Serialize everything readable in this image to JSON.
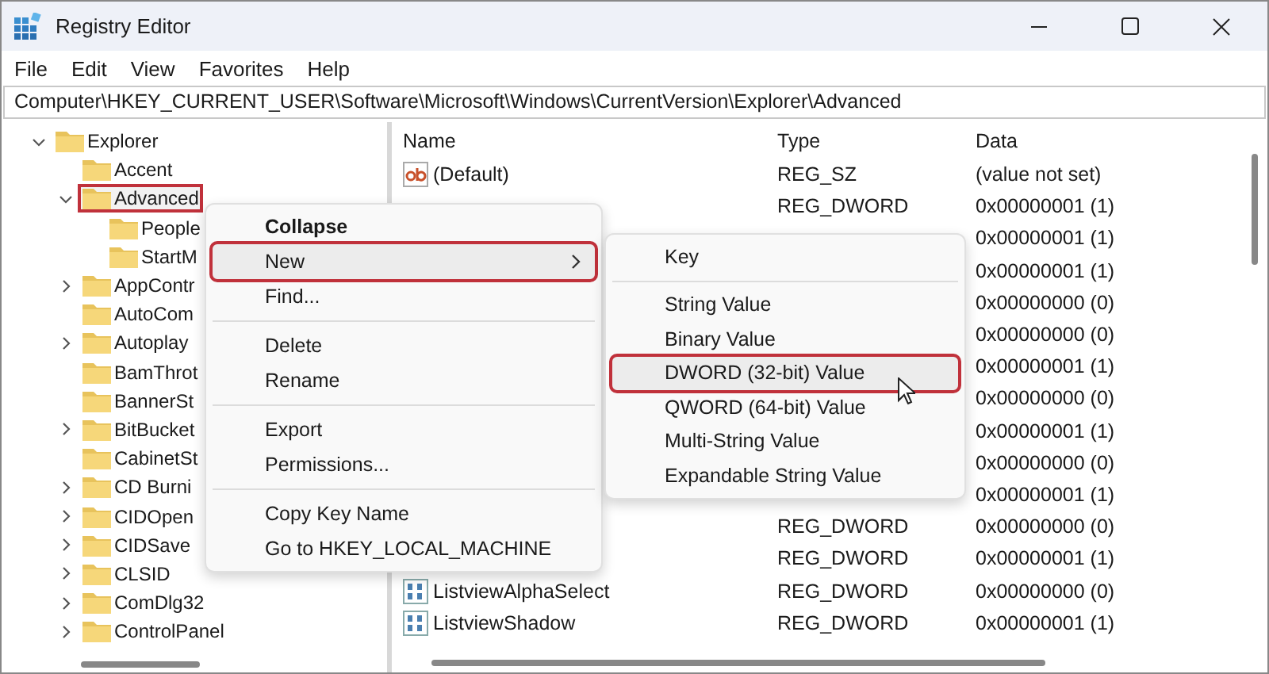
{
  "window": {
    "title": "Registry Editor"
  },
  "menu_bar": [
    "File",
    "Edit",
    "View",
    "Favorites",
    "Help"
  ],
  "address": "Computer\\HKEY_CURRENT_USER\\Software\\Microsoft\\Windows\\CurrentVersion\\Explorer\\Advanced",
  "tree": [
    {
      "label": "Explorer",
      "expanded": true,
      "highlighted": false,
      "children": [
        {
          "label": "Accent",
          "highlighted": false
        },
        {
          "label": "Advanced",
          "expanded": true,
          "highlighted": true,
          "children": [
            {
              "label": "People",
              "highlighted": false
            },
            {
              "label": "StartM",
              "highlighted": false
            }
          ]
        },
        {
          "label": "AppContr",
          "expanded": false,
          "highlighted": false
        },
        {
          "label": "AutoCom",
          "highlighted": false
        },
        {
          "label": "Autoplay",
          "expanded": false,
          "highlighted": false
        },
        {
          "label": "BamThrot",
          "highlighted": false
        },
        {
          "label": "BannerSt",
          "highlighted": false
        },
        {
          "label": "BitBucket",
          "expanded": false,
          "highlighted": false
        },
        {
          "label": "CabinetSt",
          "highlighted": false
        },
        {
          "label": "CD Burni",
          "expanded": false,
          "highlighted": false
        },
        {
          "label": "CIDOpen",
          "expanded": false,
          "highlighted": false
        },
        {
          "label": "CIDSave",
          "expanded": false,
          "highlighted": false
        },
        {
          "label": "CLSID",
          "expanded": false,
          "highlighted": false
        },
        {
          "label": "ComDlg32",
          "expanded": false,
          "highlighted": false
        },
        {
          "label": "ControlPanel",
          "expanded": false,
          "highlighted": false
        }
      ]
    }
  ],
  "table": {
    "columns": [
      "Name",
      "Type",
      "Data"
    ],
    "rows": [
      {
        "kind": "string",
        "name": "(Default)",
        "type": "REG_SZ",
        "data": "(value not set)"
      },
      {
        "type": "REG_DWORD",
        "data": "0x00000001 (1)"
      },
      {
        "data": "0x00000001 (1)"
      },
      {
        "data": "0x00000001 (1)"
      },
      {
        "data": "0x00000000 (0)"
      },
      {
        "data": "0x00000000 (0)"
      },
      {
        "data": "0x00000001 (1)"
      },
      {
        "data": "0x00000000 (0)"
      },
      {
        "data": "0x00000001 (1)"
      },
      {
        "data": "0x00000000 (0)"
      },
      {
        "data": "0x00000001 (1)"
      },
      {
        "type": "REG_DWORD",
        "data": "0x00000000 (0)"
      },
      {
        "type": "REG_DWORD",
        "data": "0x00000001 (1)"
      },
      {
        "kind": "dword",
        "name": "ListviewAlphaSelect",
        "type": "REG_DWORD",
        "data": "0x00000000 (0)"
      },
      {
        "kind": "dword",
        "name": "ListviewShadow",
        "type": "REG_DWORD",
        "data": "0x00000001 (1)"
      }
    ]
  },
  "context_menu": {
    "groups": [
      [
        {
          "label": "Collapse",
          "bold": true,
          "submenu": false,
          "highlighted": false
        },
        {
          "label": "New",
          "bold": false,
          "submenu": true,
          "highlighted": true
        },
        {
          "label": "Find...",
          "bold": false,
          "submenu": false,
          "highlighted": false
        }
      ],
      [
        {
          "label": "Delete",
          "bold": false,
          "submenu": false,
          "highlighted": false
        },
        {
          "label": "Rename",
          "bold": false,
          "submenu": false,
          "highlighted": false
        }
      ],
      [
        {
          "label": "Export",
          "bold": false,
          "submenu": false,
          "highlighted": false
        },
        {
          "label": "Permissions...",
          "bold": false,
          "submenu": false,
          "highlighted": false
        }
      ],
      [
        {
          "label": "Copy Key Name",
          "bold": false,
          "submenu": false,
          "highlighted": false
        },
        {
          "label": "Go to HKEY_LOCAL_MACHINE",
          "bold": false,
          "submenu": false,
          "highlighted": false
        }
      ]
    ]
  },
  "submenu": {
    "groups": [
      [
        {
          "label": "Key",
          "highlighted": false
        }
      ],
      [
        {
          "label": "String Value",
          "highlighted": false
        },
        {
          "label": "Binary Value",
          "highlighted": false
        },
        {
          "label": "DWORD (32-bit) Value",
          "highlighted": true
        },
        {
          "label": "QWORD (64-bit) Value",
          "highlighted": false
        },
        {
          "label": "Multi-String Value",
          "highlighted": false
        },
        {
          "label": "Expandable String Value",
          "highlighted": false
        }
      ]
    ]
  }
}
